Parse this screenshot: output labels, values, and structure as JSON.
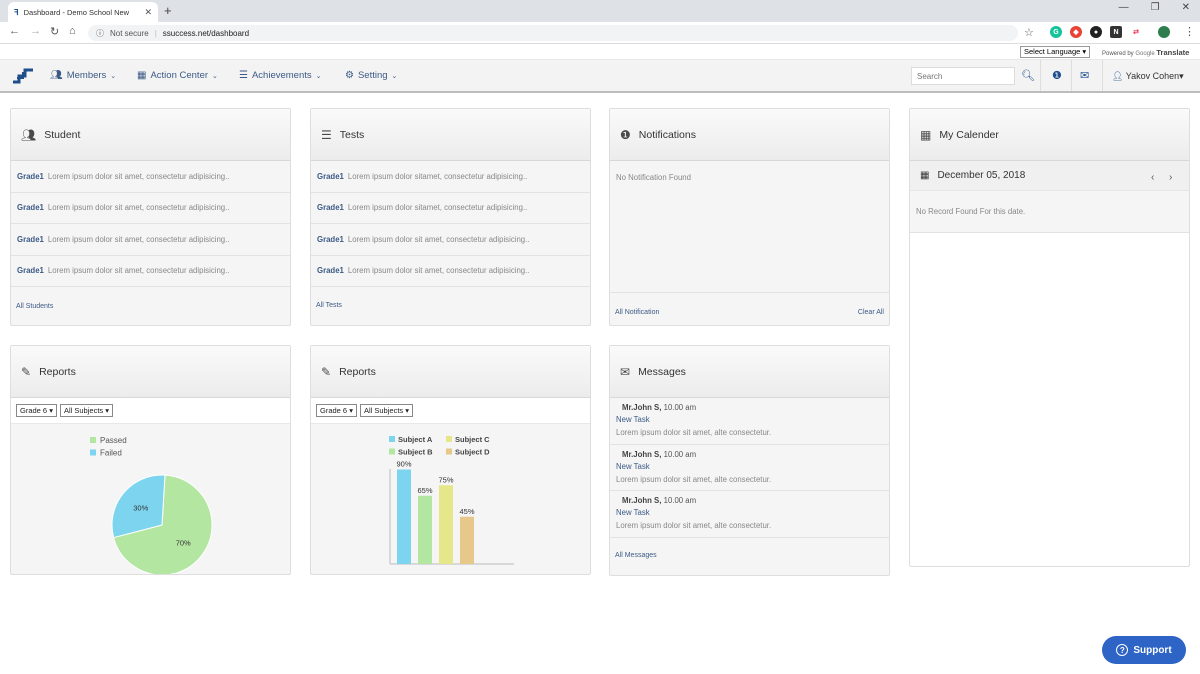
{
  "browser": {
    "tab_title": "Dashboard - Demo School New",
    "not_secure": "Not secure",
    "url": "ssuccess.net/dashboard",
    "translate_select": "Select Language",
    "powered_by": "Powered by",
    "google": "Google",
    "translate": "Translate"
  },
  "navbar": {
    "logo": "SS",
    "menu": [
      {
        "label": "Members",
        "icon": "users-icon"
      },
      {
        "label": "Action Center",
        "icon": "calendar-icon"
      },
      {
        "label": "Achievements",
        "icon": "list-icon"
      },
      {
        "label": "Setting",
        "icon": "gear-icon"
      }
    ],
    "search_placeholder": "Search",
    "user_name": "Yakov Cohen"
  },
  "student": {
    "title": "Student",
    "rows": [
      {
        "grade": "Grade1",
        "text": "Lorem ipsum dolor sit amet, consectetur adipisicing.."
      },
      {
        "grade": "Grade1",
        "text": "Lorem ipsum dolor sit amet, consectetur adipisicing.."
      },
      {
        "grade": "Grade1",
        "text": "Lorem ipsum dolor sit amet, consectetur adipisicing.."
      },
      {
        "grade": "Grade1",
        "text": "Lorem ipsum dolor sit amet, consectetur adipisicing.."
      }
    ],
    "link": "All Students"
  },
  "tests": {
    "title": "Tests",
    "rows": [
      {
        "grade": "Grade1",
        "text": "Lorem ipsum dolor sitamet, consectetur adipisicing.."
      },
      {
        "grade": "Grade1",
        "text": "Lorem ipsum dolor sitamet, consectetur adipisicing.."
      },
      {
        "grade": "Grade1",
        "text": "Lorem ipsum dolor sit amet, consectetur adipisicing.."
      },
      {
        "grade": "Grade1",
        "text": "Lorem ipsum dolor sit amet, consectetur adipisicing.."
      }
    ],
    "link": "All Tests"
  },
  "notifications": {
    "title": "Notifications",
    "empty": "No Notification Found",
    "link_all": "All Notification",
    "link_clear": "Clear All"
  },
  "calendar": {
    "title": "My Calender",
    "date": "December 05, 2018",
    "empty": "No Record Found For this date."
  },
  "reports1": {
    "title": "Reports",
    "grade": "Grade 6",
    "subject": "All Subjects"
  },
  "reports2": {
    "title": "Reports",
    "grade": "Grade 6",
    "subject": "All Subjects"
  },
  "messages": {
    "title": "Messages",
    "items": [
      {
        "from": "Mr.John S,",
        "time": "10.00 am",
        "subject": "New Task",
        "body": "Lorem ipsum dolor sit amet, alte consectetur."
      },
      {
        "from": "Mr.John S,",
        "time": "10.00 am",
        "subject": "New Task",
        "body": "Lorem ipsum dolor sit amet, alte consectetur."
      },
      {
        "from": "Mr.John S,",
        "time": "10.00 am",
        "subject": "New Task",
        "body": "Lorem ipsum dolor sit amet, alte consectetur."
      }
    ],
    "link": "All Messages"
  },
  "support": {
    "label": "Support"
  },
  "chart_data": [
    {
      "type": "pie",
      "labels": [
        "Passed",
        "Failed"
      ],
      "values": [
        70,
        30
      ],
      "value_labels": [
        "70%",
        "30%"
      ],
      "colors": [
        "#b3e6a0",
        "#7dd4ee"
      ],
      "legend": "top"
    },
    {
      "type": "bar",
      "categories": [
        "Subject A",
        "Subject B",
        "Subject C",
        "Subject D"
      ],
      "values": [
        90,
        65,
        75,
        45
      ],
      "value_labels": [
        "90%",
        "65%",
        "75%",
        "45%"
      ],
      "colors": [
        "#7dd4ee",
        "#b3e6a0",
        "#e6e68a",
        "#e6c88a"
      ],
      "ylim": [
        0,
        100
      ],
      "legend": "top"
    }
  ]
}
